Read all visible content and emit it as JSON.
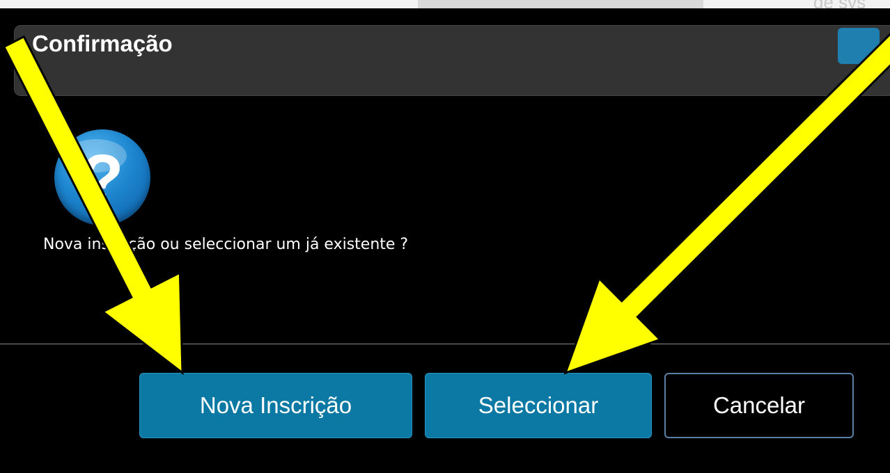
{
  "background": {
    "partial_text": "de sys"
  },
  "dialog": {
    "title": "Confirmação",
    "icon": "question-icon",
    "message": "Nova inscrição ou seleccionar um já existente ?",
    "buttons": {
      "new": "Nova Inscrição",
      "select": "Seleccionar",
      "cancel": "Cancelar"
    }
  },
  "colors": {
    "dialog_bg": "#000000",
    "titlebar_bg": "#333333",
    "button_primary": "#0b79a4",
    "annotation_arrow": "#ffff00"
  }
}
